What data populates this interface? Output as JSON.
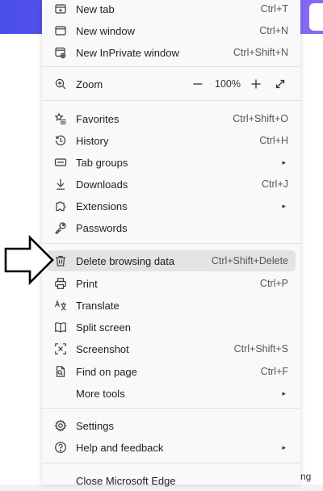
{
  "menu": {
    "items": [
      {
        "name": "new-tab",
        "label": "New tab",
        "shortcut": "Ctrl+T",
        "icon": "new-tab-icon"
      },
      {
        "name": "new-window",
        "label": "New window",
        "shortcut": "Ctrl+N",
        "icon": "window-icon"
      },
      {
        "name": "new-inprivate-window",
        "label": "New InPrivate window",
        "shortcut": "Ctrl+Shift+N",
        "icon": "inprivate-icon"
      },
      {
        "name": "favorites",
        "label": "Favorites",
        "shortcut": "Ctrl+Shift+O",
        "icon": "star-list-icon"
      },
      {
        "name": "history",
        "label": "History",
        "shortcut": "Ctrl+H",
        "icon": "history-icon"
      },
      {
        "name": "tab-groups",
        "label": "Tab groups",
        "shortcut": "",
        "icon": "tab-groups-icon",
        "submenu": true
      },
      {
        "name": "downloads",
        "label": "Downloads",
        "shortcut": "Ctrl+J",
        "icon": "download-icon"
      },
      {
        "name": "extensions",
        "label": "Extensions",
        "shortcut": "",
        "icon": "puzzle-icon",
        "submenu": true
      },
      {
        "name": "passwords",
        "label": "Passwords",
        "shortcut": "",
        "icon": "key-icon"
      },
      {
        "name": "delete-browsing-data",
        "label": "Delete browsing data",
        "shortcut": "Ctrl+Shift+Delete",
        "icon": "trash-icon",
        "highlighted": true
      },
      {
        "name": "print",
        "label": "Print",
        "shortcut": "Ctrl+P",
        "icon": "printer-icon"
      },
      {
        "name": "translate",
        "label": "Translate",
        "shortcut": "",
        "icon": "translate-icon"
      },
      {
        "name": "split-screen",
        "label": "Split screen",
        "shortcut": "",
        "icon": "split-screen-icon"
      },
      {
        "name": "screenshot",
        "label": "Screenshot",
        "shortcut": "Ctrl+Shift+S",
        "icon": "screenshot-icon"
      },
      {
        "name": "find-on-page",
        "label": "Find on page",
        "shortcut": "Ctrl+F",
        "icon": "find-page-icon"
      },
      {
        "name": "more-tools",
        "label": "More tools",
        "shortcut": "",
        "icon": "",
        "submenu": true
      },
      {
        "name": "settings",
        "label": "Settings",
        "shortcut": "",
        "icon": "gear-icon"
      },
      {
        "name": "help-and-feedback",
        "label": "Help and feedback",
        "shortcut": "",
        "icon": "help-icon",
        "submenu": true
      },
      {
        "name": "close-microsoft-edge",
        "label": "Close Microsoft Edge",
        "shortcut": "",
        "icon": ""
      }
    ],
    "zoom": {
      "label": "Zoom",
      "value": "100%",
      "icon": "zoom-icon"
    },
    "submenu_glyph": "▸"
  },
  "background": {
    "partial_text": "ng"
  },
  "colors": {
    "menu_bg": "#f9f9fb",
    "highlight_bg": "#e3e3e3",
    "banner_start": "#4a4ee8",
    "banner_end": "#8a6af5"
  }
}
